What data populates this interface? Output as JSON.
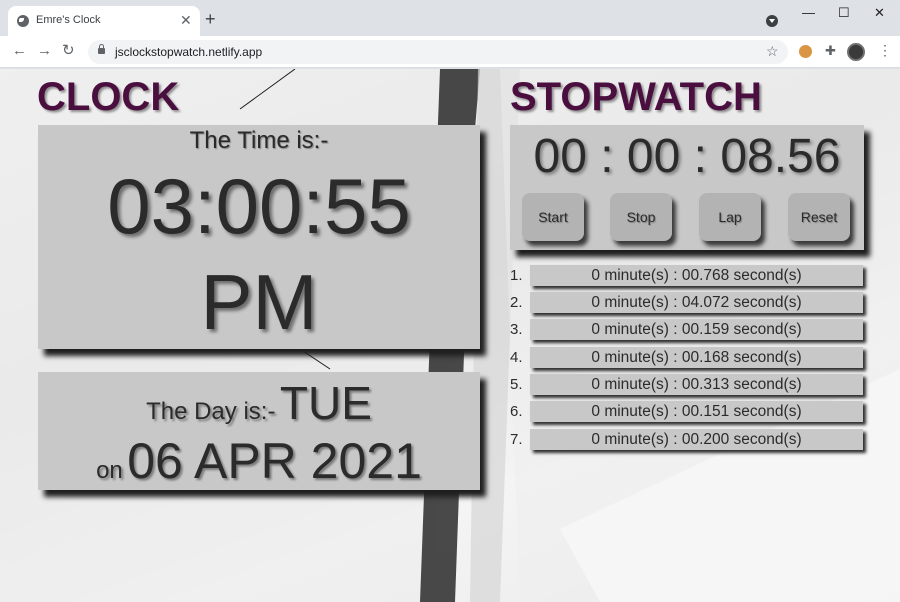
{
  "browser": {
    "tab_title": "Emre's Clock",
    "tab_close": "✕",
    "new_tab": "+",
    "url": "jsclockstopwatch.netlify.app",
    "window_controls": {
      "minimize": "—",
      "maximize": "☐",
      "close": "✕"
    },
    "nav": {
      "back": "←",
      "forward": "→",
      "reload": "↻"
    },
    "star": "☆",
    "puzzle": "✚",
    "menu": "⋮"
  },
  "clock": {
    "heading": "CLOCK",
    "time_label": "The Time is:-",
    "time": "03:00:55",
    "ampm": "PM",
    "day_label": "The Day is:-",
    "day": "TUE",
    "on_label": "on",
    "date": "06 APR 2021"
  },
  "stopwatch": {
    "heading": "STOPWATCH",
    "value": "00 : 00 : 08.56",
    "buttons": {
      "start": "Start",
      "stop": "Stop",
      "lap": "Lap",
      "reset": "Reset"
    },
    "laps": [
      {
        "num": "1.",
        "text": "0 minute(s) : 00.768 second(s)"
      },
      {
        "num": "2.",
        "text": "0 minute(s) : 04.072 second(s)"
      },
      {
        "num": "3.",
        "text": "0 minute(s) : 00.159 second(s)"
      },
      {
        "num": "4.",
        "text": "0 minute(s) : 00.168 second(s)"
      },
      {
        "num": "5.",
        "text": "0 minute(s) : 00.313 second(s)"
      },
      {
        "num": "6.",
        "text": "0 minute(s) : 00.151 second(s)"
      },
      {
        "num": "7.",
        "text": "0 minute(s) : 00.200 second(s)"
      }
    ]
  }
}
